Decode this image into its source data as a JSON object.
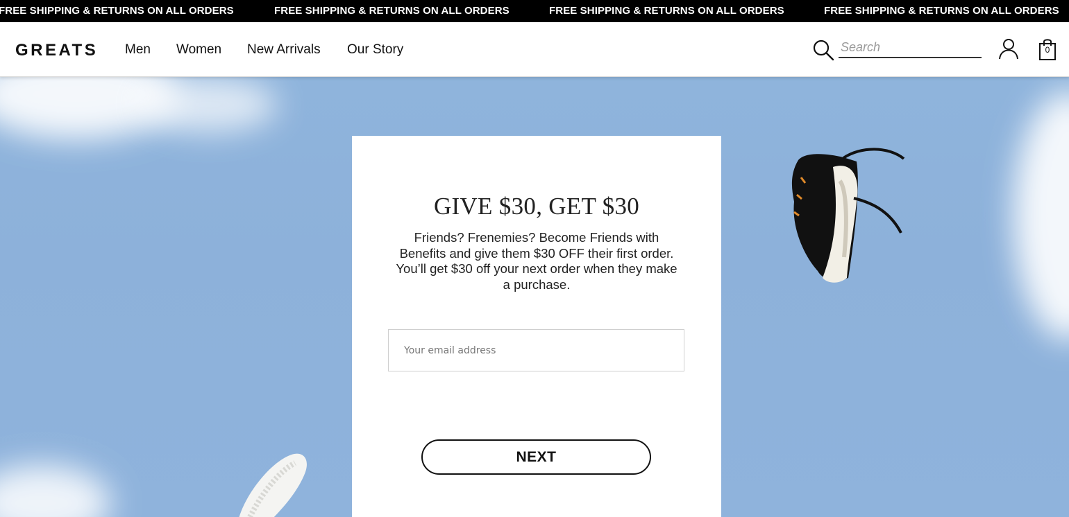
{
  "announcement": {
    "messages": [
      "FREE SHIPPING & RETURNS ON ALL ORDERS",
      "FREE SHIPPING & RETURNS ON ALL ORDERS",
      "FREE SHIPPING & RETURNS ON ALL ORDERS",
      "FREE SHIPPING & RETURNS ON ALL ORDERS"
    ]
  },
  "header": {
    "logo": "GREATS",
    "nav": [
      "Men",
      "Women",
      "New Arrivals",
      "Our Story"
    ],
    "search_placeholder": "Search",
    "icons": [
      "search-icon",
      "account-icon",
      "shopping-bag-icon"
    ],
    "cart_count": "0"
  },
  "modal": {
    "title": "GIVE $30, GET $30",
    "body": "Friends? Frenemies? Become Friends with Benefits and give them $30 OFF their first order. You’ll get $30 off your next order when they make a purchase.",
    "email_placeholder": "Your email address",
    "next_label": "NEXT"
  },
  "colors": {
    "announcement_bg": "#000000",
    "sky": "#8fb4dc",
    "card_bg": "#ffffff",
    "text": "#222222"
  }
}
